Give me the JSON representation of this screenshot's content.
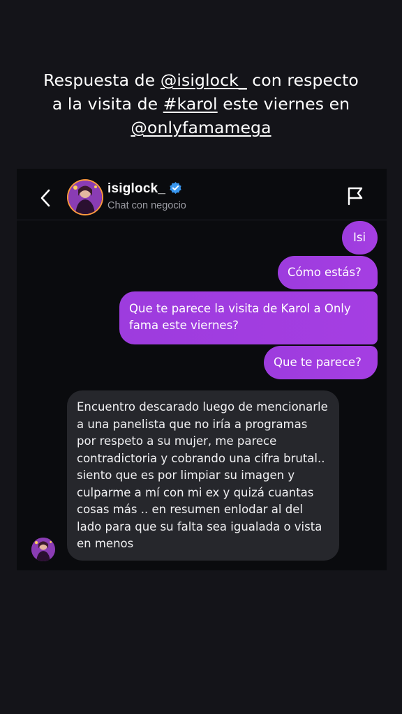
{
  "caption": {
    "line1_text": "Respuesta de ",
    "line1_mention": "@isiglock_",
    "line1_end": " con respecto",
    "line2_text": "a la visita de ",
    "line2_hashtag": "#karol",
    "line2_end": " este viernes en",
    "line3_mention": "@onlyfamamega"
  },
  "header": {
    "username": "isiglock_",
    "subtitle": "Chat con negocio",
    "back_icon": "chevron-left-icon",
    "report_icon": "flag-icon",
    "verified_icon": "verified-badge-icon"
  },
  "messages": {
    "out": [
      "Isi",
      "Cómo estás?",
      "Que te parece la visita de Karol a Only fama este viernes?",
      "Que te parece?"
    ],
    "in": [
      "Encuentro descarado luego de mencionarle a una panelista que no iría a programas por respeto a su mujer, me parece contradictoria y cobrando una cifra brutal.. siento que es por limpiar su imagen y culparme a mí con mi ex y quizá cuantas cosas más .. en resumen enlodar al del lado para que su falta sea igualada o vista en menos"
    ]
  },
  "colors": {
    "background": "#141419",
    "card": "#0a0b0e",
    "outgoing_bubble": "#a03de0",
    "incoming_bubble": "#26272c",
    "verified": "#3897f0",
    "avatar_ring": "#ff9b3d"
  }
}
